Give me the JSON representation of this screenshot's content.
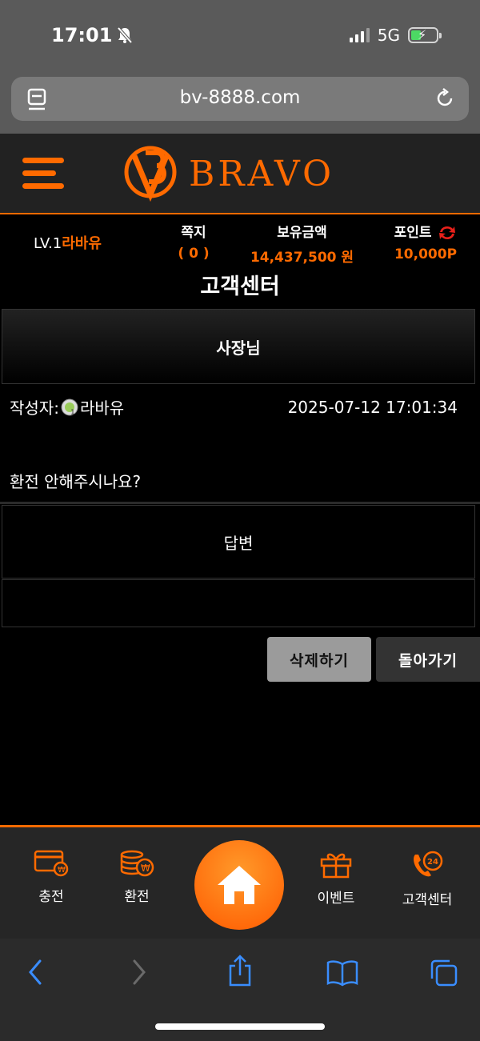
{
  "status_bar": {
    "time": "17:01",
    "network": "5G"
  },
  "browser": {
    "url": "bv-8888.com"
  },
  "site": {
    "logo_text": "BRAVO"
  },
  "user": {
    "level": "LV.1",
    "nickname": "라바유",
    "messages_label": "쪽지",
    "messages_value": "( 0 )",
    "balance_label": "보유금액",
    "balance_value": "14,437,500 원",
    "points_label": "포인트",
    "points_value": "10,000P"
  },
  "page": {
    "title": "고객센터",
    "subject": "사장님",
    "author_label": "작성자:",
    "author_name": "라바유",
    "datetime": "2025-07-12 17:01:34",
    "content": "환전 안해주시나요?",
    "answer_label": "답변",
    "answer_content": ""
  },
  "buttons": {
    "delete": "삭제하기",
    "back": "돌아가기"
  },
  "bottom_nav": {
    "charge": "충전",
    "exchange": "환전",
    "event": "이벤트",
    "support": "고객센터"
  },
  "colors": {
    "accent": "#ff6a00",
    "background": "#000000"
  }
}
